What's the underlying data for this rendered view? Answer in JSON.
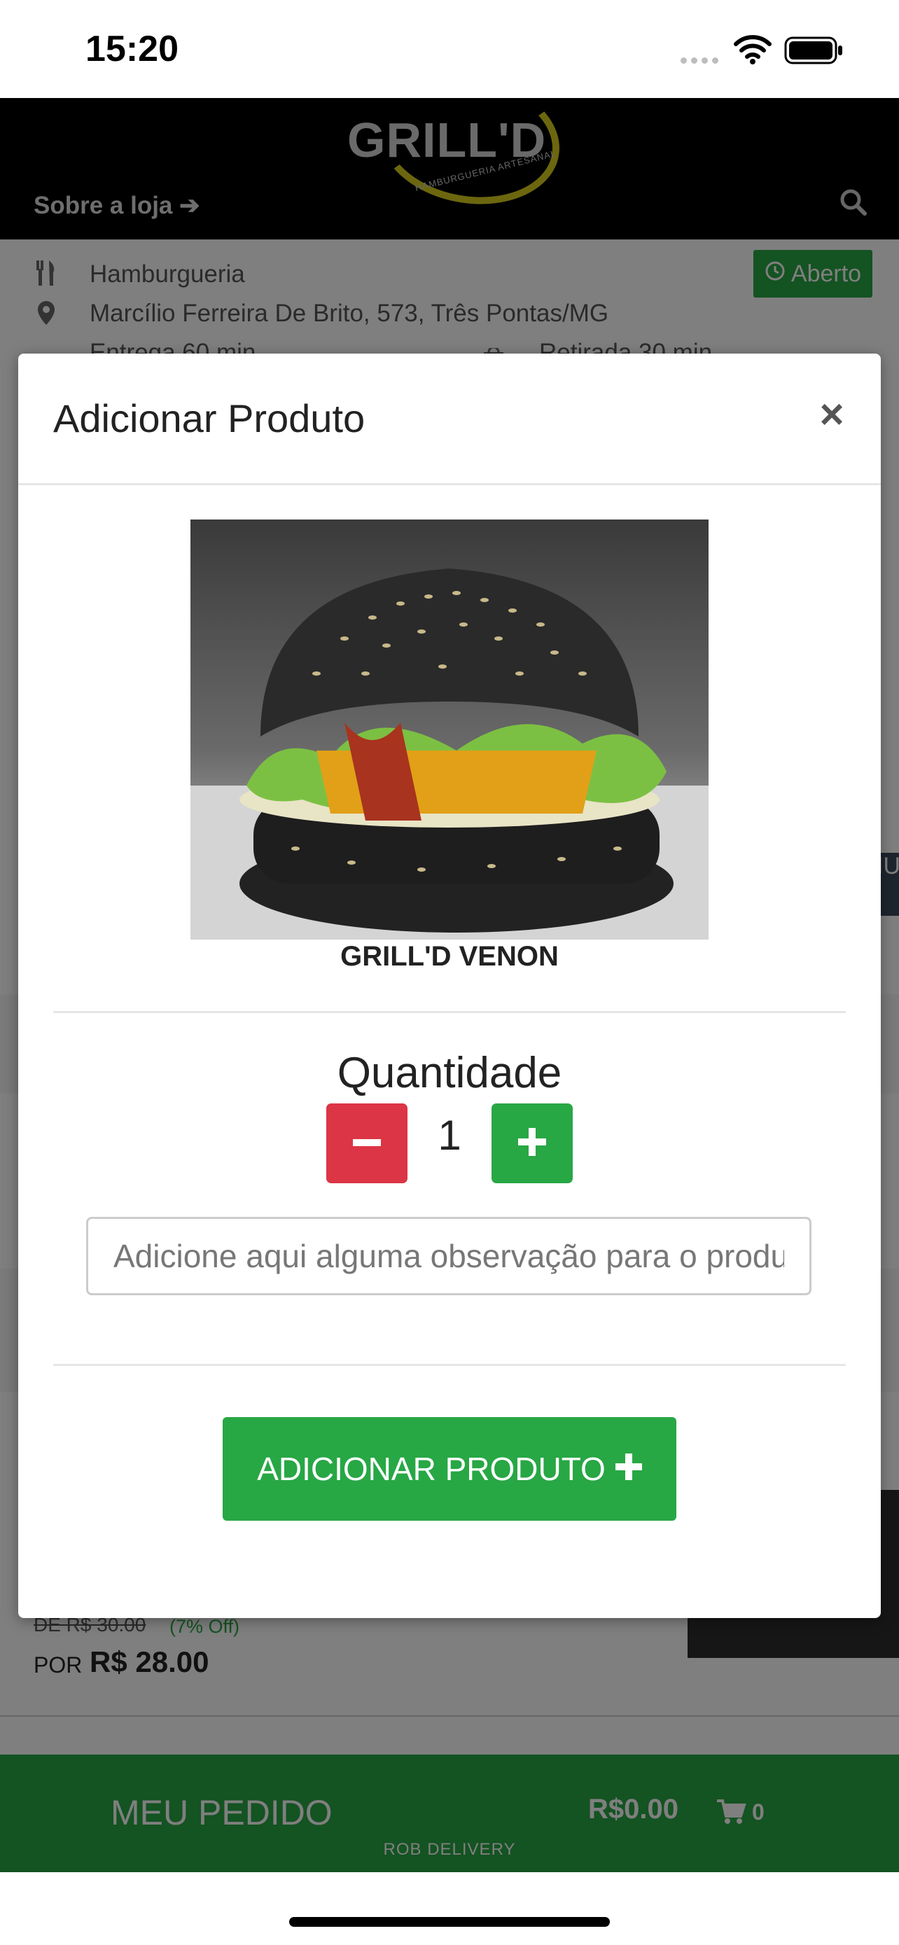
{
  "status_bar": {
    "time": "15:20"
  },
  "header": {
    "logo_text": "GRILL'D",
    "logo_subtitle": "HAMBURGUERIA ARTESANAL",
    "about_link": "Sobre a loja",
    "about_arrow": "➔"
  },
  "store_info": {
    "category": "Hamburgueria",
    "address": "Marcílio Ferreira De Brito, 573, Três Pontas/MG",
    "delivery": "Entrega 60 min",
    "pickup": "Retirada 30 min",
    "status": "Aberto",
    "side_tab": "IU"
  },
  "background_product": {
    "old_price": "DE R$ 30.00",
    "discount": "(7% Off)",
    "price_prefix": "POR",
    "price": "R$ 28.00"
  },
  "order_bar": {
    "label": "MEU PEDIDO",
    "total": "R$0.00",
    "count": "0",
    "brand": "ROB DELIVERY"
  },
  "modal": {
    "title": "Adicionar Produto",
    "close": "×",
    "product_name": "GRILL'D VENON",
    "quantity_label": "Quantidade",
    "quantity": "1",
    "observation_placeholder": "Adicione aqui alguma observação para o produto",
    "observation_value": "",
    "add_button": "ADICIONAR PRODUTO"
  },
  "colors": {
    "green": "#28a745",
    "red": "#dc3545",
    "header_bg": "#000000",
    "logo_yellow": "#d8cf1d"
  },
  "icons": [
    "wifi-icon",
    "battery-icon",
    "search-icon",
    "utensils-icon",
    "map-pin-icon",
    "moto-icon",
    "bag-icon",
    "clock-icon",
    "close-icon",
    "minus-icon",
    "plus-icon",
    "cart-icon"
  ]
}
